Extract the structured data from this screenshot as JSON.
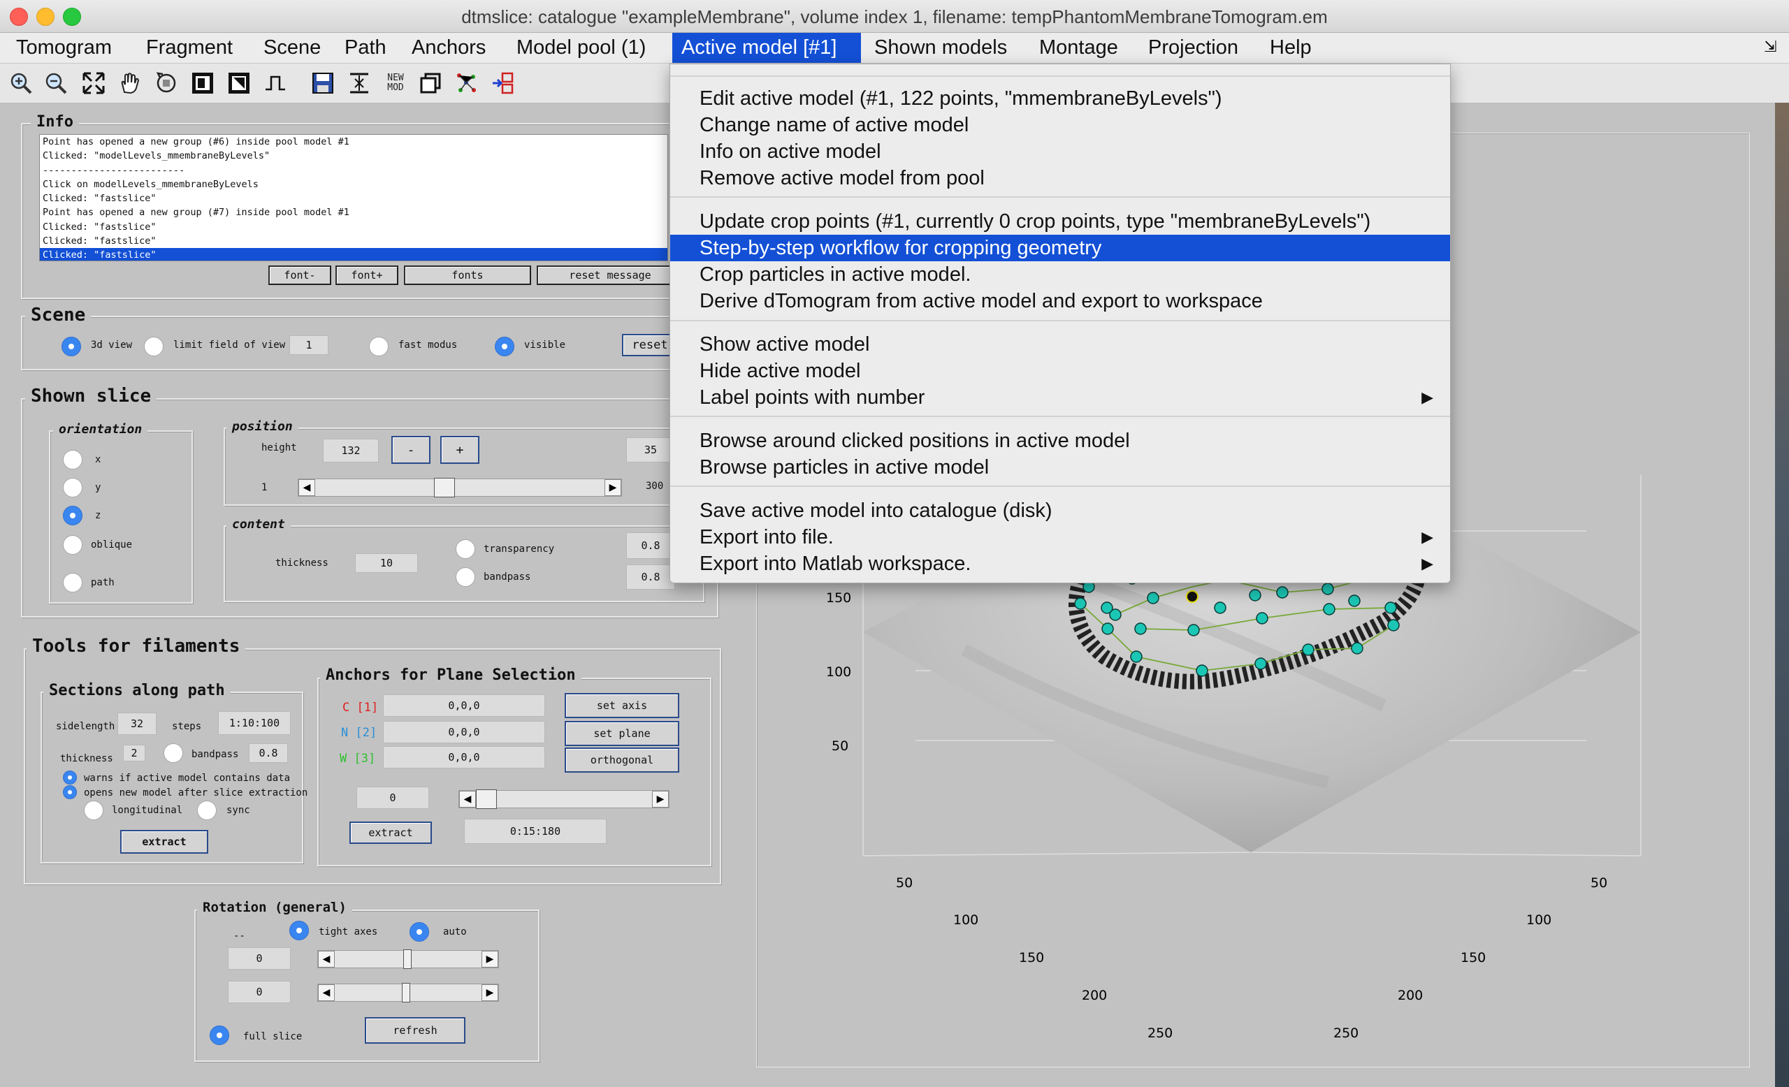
{
  "window": {
    "title": "dtmslice: catalogue \"exampleMembrane\", volume index 1, filename: tempPhantomMembraneTomogram.em"
  },
  "menubar": {
    "items": [
      "Tomogram",
      "Fragment",
      "Scene",
      "Path",
      "Anchors",
      "Model pool (1)",
      "Active model [#1]",
      "Shown models",
      "Montage",
      "Projection",
      "Help"
    ],
    "active_index": 6,
    "corner_glyph": "⇲"
  },
  "toolbar": {
    "new_mod_line1": "NEW",
    "new_mod_line2": "MOD"
  },
  "info": {
    "title": "Info",
    "lines": [
      "Point has opened a new group (#6) inside pool model #1",
      "Clicked: \"modelLevels_mmembraneByLevels\"",
      "-------------------------",
      "Click on modelLevels_mmembraneByLevels",
      "Clicked: \"fastslice\"",
      "Point has opened a new group (#7) inside pool model #1",
      "Clicked: \"fastslice\"",
      "Clicked: \"fastslice\"",
      "Clicked: \"fastslice\""
    ],
    "selected_index": 8,
    "buttons": [
      "font-",
      "font+",
      "fonts",
      "reset message"
    ]
  },
  "scene": {
    "title": "Scene",
    "view3d": "3d view",
    "limit_fov": "limit field of view",
    "fov_value": "1",
    "fast_modus": "fast modus",
    "visible": "visible",
    "reset": "reset"
  },
  "shown_slice": {
    "title": "Shown slice",
    "orientation_title": "orientation",
    "orientations": [
      "x",
      "y",
      "z",
      "oblique",
      "path"
    ],
    "orientation_selected": 2,
    "position_title": "position",
    "height_label": "height",
    "height_value": "132",
    "minus": "-",
    "plus": "+",
    "right_value": "35",
    "slider_min": "1",
    "slider_max": "300",
    "slider_fraction": 0.44,
    "content_title": "content",
    "thickness_label": "thickness",
    "thickness_value": "10",
    "transparency_label": "transparency",
    "transparency_value": "0.8",
    "bandpass_label": "bandpass",
    "bandpass_value": "0.8"
  },
  "tools": {
    "title": "Tools for filaments",
    "sections_title": "Sections along path",
    "sidelength_label": "sidelength",
    "sidelength_value": "32",
    "steps_label": "steps",
    "steps_value": "1:10:100",
    "thickness_label": "thickness",
    "thickness_value": "2",
    "bandpass_label": "bandpass",
    "bandpass_value": "0.8",
    "warns": "warns if active model contains data",
    "opens": "opens new model after slice extraction",
    "longitudinal": "longitudinal",
    "sync": "sync",
    "extract": "extract",
    "anchors_title": "Anchors for Plane Selection",
    "anchor_c": "C [1]",
    "anchor_n": "N [2]",
    "anchor_w": "W [3]",
    "anchor_c_val": "0,0,0",
    "anchor_n_val": "0,0,0",
    "anchor_w_val": "0,0,0",
    "set_axis": "set axis",
    "set_plane": "set plane",
    "orthogonal": "orthogonal",
    "anchor_slider_value": "0",
    "extract2": "extract",
    "range_value": "0:15:180",
    "color_c": "#e02020",
    "color_n": "#2a8fd8",
    "color_w": "#30c030"
  },
  "rotation": {
    "title": "Rotation (general)",
    "dash": "--",
    "tight_axes": "tight axes",
    "auto": "auto",
    "value1": "0",
    "value2": "0",
    "full_slice": "full slice",
    "refresh": "refresh"
  },
  "plot": {
    "left_ticks": [
      "150",
      "100",
      "50"
    ],
    "bottom_left_ticks": [
      "50",
      "100",
      "150",
      "200",
      "250"
    ],
    "bottom_right_ticks": [
      "50",
      "100",
      "150",
      "200",
      "250"
    ],
    "point_color": "#1cc6b4"
  },
  "dropdown": {
    "groups": [
      [
        "Edit active model (#1, 122 points, \"mmembraneByLevels\")",
        "Change name of active model",
        "Info on active model",
        "Remove active model from pool"
      ],
      [
        "Update crop points (#1, currently 0 crop points, type \"membraneByLevels\")",
        "Step-by-step workflow for cropping geometry",
        "Crop particles in active model.",
        "Derive dTomogram from active model and export to workspace"
      ],
      [
        "Show active model",
        "Hide active model",
        "Label points with number"
      ],
      [
        "Browse around clicked positions in active model",
        "Browse particles in active model"
      ],
      [
        "Save active model into catalogue (disk)",
        "Export into file.",
        "Export into Matlab workspace."
      ]
    ],
    "highlighted": "Step-by-step workflow for cropping geometry",
    "submenu_glyph": "▶"
  }
}
